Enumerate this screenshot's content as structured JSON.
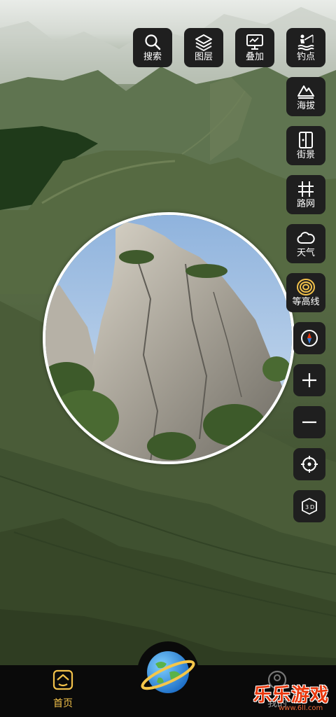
{
  "toolbar": {
    "search": {
      "label": "搜索",
      "icon": "search-icon"
    },
    "layers": {
      "label": "图层",
      "icon": "layers-icon"
    },
    "overlay": {
      "label": "叠加",
      "icon": "overlay-icon"
    },
    "fishing": {
      "label": "钓点",
      "icon": "fishing-spot-icon"
    }
  },
  "side": {
    "altitude": {
      "label": "海拔",
      "icon": "mountain-icon"
    },
    "streetview": {
      "label": "街景",
      "icon": "street-view-icon"
    },
    "roads": {
      "label": "路网",
      "icon": "road-network-icon"
    },
    "weather": {
      "label": "天气",
      "icon": "cloud-icon"
    },
    "contour": {
      "label": "等高线",
      "icon": "contour-icon"
    },
    "compass": {
      "icon": "compass-icon"
    },
    "zoom_in": {
      "icon": "plus-icon"
    },
    "zoom_out": {
      "icon": "minus-icon"
    },
    "locate": {
      "icon": "crosshair-icon"
    },
    "mode3d": {
      "icon": "3d-cube-icon"
    }
  },
  "nav": {
    "home": {
      "label": "首页",
      "icon": "home-icon"
    },
    "center": {
      "icon": "planet-icon"
    },
    "mine": {
      "label": "我的",
      "icon": "user-icon"
    }
  },
  "watermark": {
    "brand": "乐乐游戏",
    "url": "www.6ll.com"
  },
  "colors": {
    "button_bg": "#1f1f1f",
    "contour_accent": "#f2c14a",
    "nav_active": "#f2c14a",
    "watermark": "#e8380d"
  }
}
